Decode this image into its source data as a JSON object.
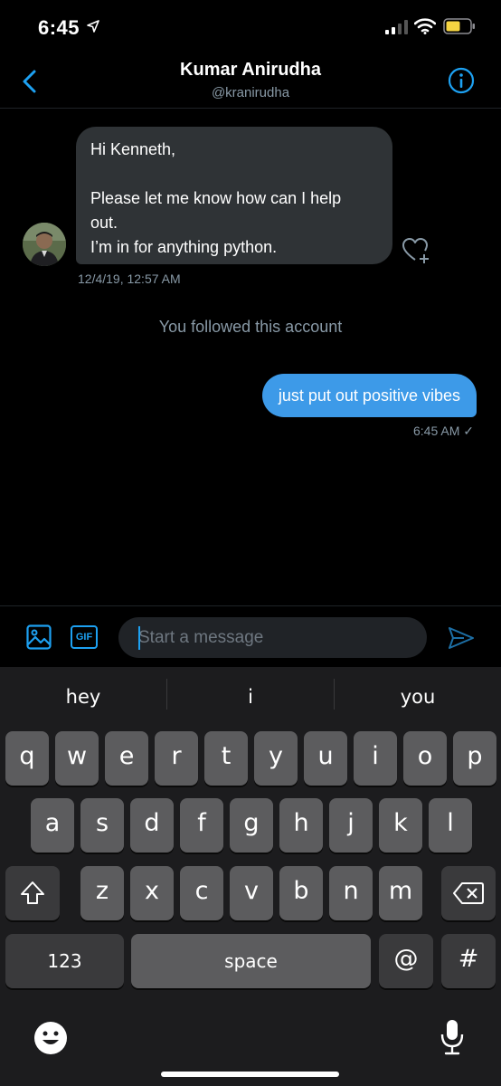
{
  "status_bar": {
    "time": "6:45"
  },
  "header": {
    "title": "Kumar Anirudha",
    "handle": "@kranirudha"
  },
  "conversation": {
    "incoming": {
      "line1": "Hi Kenneth,",
      "line2": "Please let me know how can I help",
      "line3": "out.",
      "line4": "I’m in for anything python.",
      "timestamp": "12/4/19, 12:57 AM"
    },
    "system_note": "You followed this account",
    "outgoing": {
      "text": "just put out positive vibes",
      "timestamp": "6:45 AM ✓"
    }
  },
  "composer": {
    "placeholder": "Start a message",
    "gif_label": "GIF"
  },
  "keyboard": {
    "suggestions": [
      "hey",
      "i",
      "you"
    ],
    "row1": [
      "q",
      "w",
      "e",
      "r",
      "t",
      "y",
      "u",
      "i",
      "o",
      "p"
    ],
    "row2": [
      "a",
      "s",
      "d",
      "f",
      "g",
      "h",
      "j",
      "k",
      "l"
    ],
    "row3": [
      "z",
      "x",
      "c",
      "v",
      "b",
      "n",
      "m"
    ],
    "numbers_label": "123",
    "space_label": "space",
    "at_label": "@",
    "hash_label": "#"
  },
  "colors": {
    "accent": "#1da1f2",
    "incoming_bubble": "#2f3336",
    "muted_text": "#8899a6",
    "battery": "#f5d442"
  },
  "icons": [
    "location-arrow-icon",
    "signal-icon",
    "wifi-icon",
    "battery-icon",
    "back-chevron-icon",
    "info-icon",
    "heart-add-icon",
    "image-icon",
    "gif-icon",
    "send-icon",
    "shift-icon",
    "backspace-icon",
    "emoji-icon",
    "mic-icon"
  ]
}
